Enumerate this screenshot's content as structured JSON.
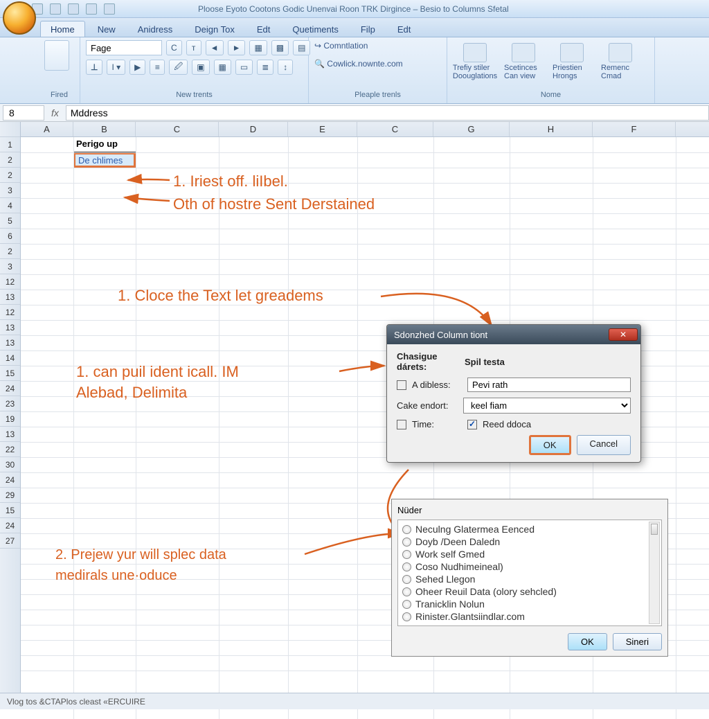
{
  "window_title": "Ploose Eyoto Cootons Godic Unenvai Roon TRK Dirgince – Besio to Columns Sfetal",
  "tabs": [
    "Home",
    "New",
    "Anidress",
    "Deign Tox",
    "Edt",
    "Quetiments",
    "Filp",
    "Edt"
  ],
  "active_tab": "Home",
  "ribbon": {
    "group1_label": "Fired",
    "font_box": "Fage",
    "group2_label": "New trents",
    "group3_label": "Pleaple trenls",
    "group3_items": [
      "Comntlation",
      "Cowlick.nownte.com"
    ],
    "group4_label": "Nome",
    "group4_buttons": [
      "Trefiy stiler Doouglations",
      "Scetinces Can view",
      "Priestien Hrongs",
      "Remenc Cmad"
    ]
  },
  "name_box": "8",
  "formula": "Mddress",
  "columns": [
    "A",
    "B",
    "C",
    "D",
    "E",
    "C",
    "G",
    "H",
    "F"
  ],
  "row_numbers": [
    "1",
    "2",
    "2",
    "3",
    "4",
    "5",
    "6",
    "2",
    "3",
    "12",
    "13",
    "12",
    "13",
    "13",
    "14",
    "15",
    "24",
    "23",
    "19",
    "13",
    "22",
    "30",
    "24",
    "29",
    "15",
    "24",
    "27"
  ],
  "cells": {
    "b1": "Perigo up",
    "b2": "De chlimes"
  },
  "annotations": {
    "a1": "1. Iriest off. liIbel.",
    "a2": "Oth of hostre Sent Derstained",
    "a3": "1. Cloce the Text let greadems",
    "a4_line1": "1. can puil ident icall. IM",
    "a4_line2": "Alebad, Delimita",
    "a5_line1": "2. Prejew yur will splec data",
    "a5_line2": "medirals une·oduce"
  },
  "dialog1": {
    "title": "Sdonzhed Column tiont",
    "section_label": "Chasigue dárets:",
    "section_label2": "Spil testa",
    "row1_label": "A dibless:",
    "row1_value": "Pevi rath",
    "row2_label": "Cake endort:",
    "row2_value": "keel fiam",
    "row3_label": "Time:",
    "row3_check_label": "Reed ddoca",
    "ok": "OK",
    "cancel": "Cancel"
  },
  "dialog2": {
    "header": "Nüder",
    "items": [
      "Neculng Glatermea Eenced",
      "Doyb /Deen Daledn",
      "Work self Gmed",
      "Coso Nudhimeineal)",
      "Sehed Llegon",
      "Oheer Reuil Data (olory sehcled)",
      "Tranicklin Nolun",
      "Rinister.Glantsiindlar.com"
    ],
    "ok": "OK",
    "cancel": "Sineri"
  },
  "status_text": "Vlog tos &CTAPlos cleast «ERCUIRE"
}
